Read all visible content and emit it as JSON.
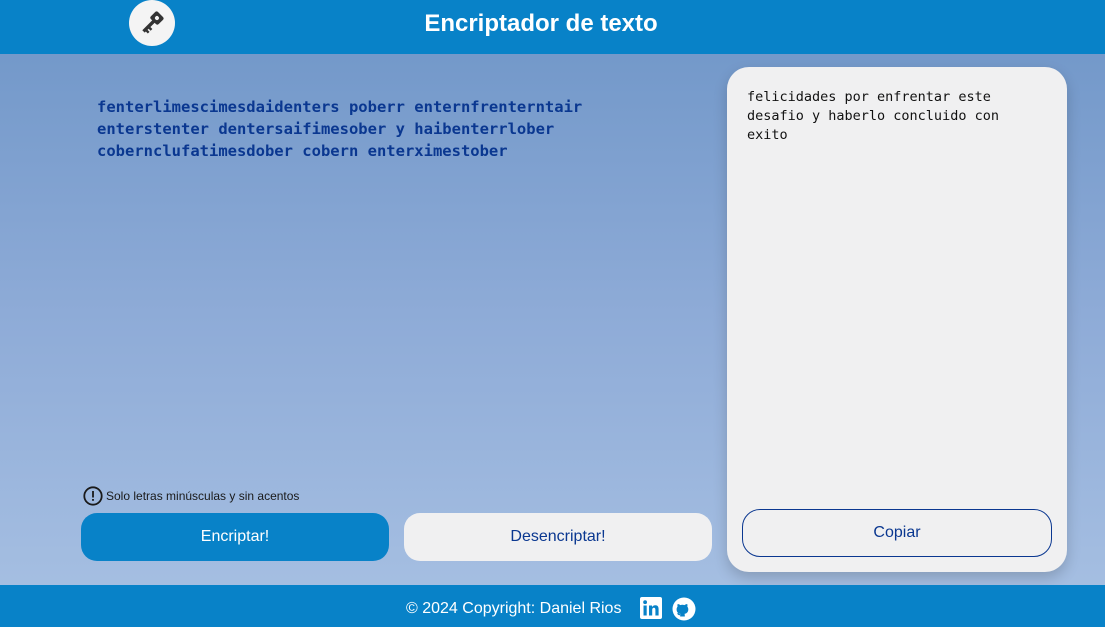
{
  "header": {
    "title": "Encriptador de texto",
    "logo_icon": "key-icon"
  },
  "input": {
    "text": "fenterlimescimesdaidenters poberr enternfrenterntair enterstenter dentersaifimesober y haibenterrlober cobernclufatimesdober cobern enterximestober"
  },
  "hint": {
    "icon": "info-icon",
    "text": "Solo letras minúsculas y sin acentos"
  },
  "buttons": {
    "encrypt_label": "Encriptar!",
    "decrypt_label": "Desencriptar!"
  },
  "output": {
    "text": "felicidades por enfrentar este desafio y haberlo concluido con exito",
    "copy_label": "Copiar"
  },
  "footer": {
    "copyright": "© 2024 Copyright: Daniel Rios",
    "links": [
      {
        "icon": "linkedin-icon"
      },
      {
        "icon": "github-icon"
      }
    ]
  },
  "colors": {
    "primary": "#0882c8",
    "text_dark_blue": "#0a3790",
    "panel": "#f0f0f1"
  }
}
